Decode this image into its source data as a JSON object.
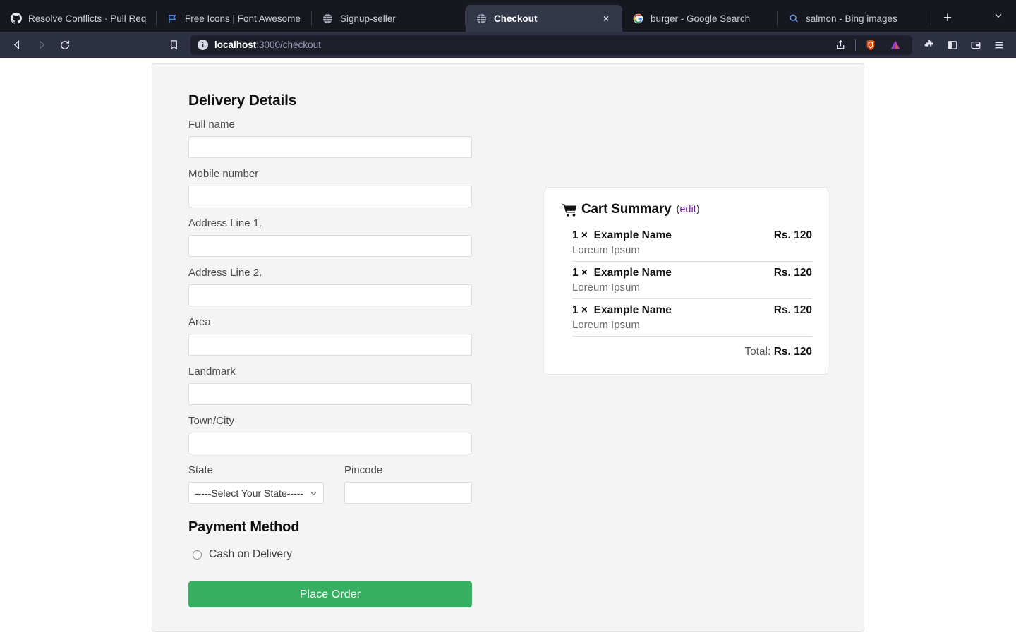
{
  "browser": {
    "tabs": [
      {
        "label": "Resolve Conflicts · Pull Request",
        "favicon": "github-icon",
        "active": false
      },
      {
        "label": "Free Icons | Font Awesome",
        "favicon": "flag-icon",
        "active": false
      },
      {
        "label": "Signup-seller",
        "favicon": "globe-icon",
        "active": false
      },
      {
        "label": "Checkout",
        "favicon": "globe-icon",
        "active": true,
        "close_label": "×"
      },
      {
        "label": "burger - Google Search",
        "favicon": "google-icon",
        "active": false
      },
      {
        "label": "salmon - Bing images",
        "favicon": "search-icon",
        "active": false
      }
    ],
    "new_tab_label": "+",
    "tab_list_label": "⌄",
    "nav": {
      "back_label": "◁",
      "forward_label": "▷",
      "reload_label": "↻",
      "bookmark_label": "bookmark-icon"
    },
    "url": {
      "host": "localhost",
      "path": ":3000/checkout",
      "info_label": "i",
      "share_label": "share-icon",
      "shield_label": "brave-shield-icon",
      "brave_label": "brave-triangle-icon"
    },
    "toolbar_icons": [
      "extensions-puzzle-icon",
      "sidebar-panel-icon",
      "wallet-icon",
      "app-menu-icon"
    ]
  },
  "checkout": {
    "delivery": {
      "title": "Delivery Details",
      "fields": [
        {
          "label": "Full name",
          "value": "",
          "placeholder": ""
        },
        {
          "label": "Mobile number",
          "value": "",
          "placeholder": ""
        },
        {
          "label": "Address Line 1.",
          "value": "",
          "placeholder": ""
        },
        {
          "label": "Address Line 2.",
          "value": "",
          "placeholder": ""
        },
        {
          "label": "Area",
          "value": "",
          "placeholder": ""
        },
        {
          "label": "Landmark",
          "value": "",
          "placeholder": ""
        },
        {
          "label": "Town/City",
          "value": "",
          "placeholder": ""
        }
      ],
      "state": {
        "label": "State",
        "selected": "-----Select Your State-----",
        "options": [
          "-----Select Your State-----"
        ]
      },
      "pincode": {
        "label": "Pincode",
        "value": "",
        "placeholder": ""
      }
    },
    "payment": {
      "title": "Payment Method",
      "options": [
        {
          "label": "Cash on Delivery",
          "selected": false
        }
      ]
    },
    "submit_label": "Place Order",
    "cart": {
      "title": "Cart Summary",
      "edit_open": "(",
      "edit_label": "edit",
      "edit_close": ")",
      "items": [
        {
          "qty": "1 ×",
          "name": "Example Name",
          "desc": "Loreum Ipsum",
          "price": "Rs. 120"
        },
        {
          "qty": "1 ×",
          "name": "Example Name",
          "desc": "Loreum Ipsum",
          "price": "Rs. 120"
        },
        {
          "qty": "1 ×",
          "name": "Example Name",
          "desc": "Loreum Ipsum",
          "price": "Rs. 120"
        }
      ],
      "total_label": "Total:",
      "total_value": "Rs. 120"
    }
  },
  "colors": {
    "accent_green": "#36b060",
    "edit_link": "#7b1fa2",
    "chrome_bg": "#17181f",
    "navbar_bg": "#2c3042"
  }
}
